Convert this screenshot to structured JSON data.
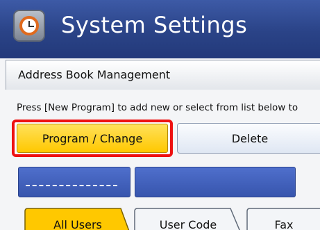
{
  "header": {
    "title": "System Settings",
    "icon": "system-settings-clock-icon"
  },
  "subheader": {
    "title": "Address Book Management"
  },
  "instruction": "Press [New Program] to add new or select from list below to",
  "buttons": {
    "program_change": "Program / Change",
    "delete": "Delete"
  },
  "fields": {
    "first_placeholder": "------"
  },
  "tabs": [
    {
      "label": "All Users",
      "selected": true
    },
    {
      "label": "User Code",
      "selected": false
    },
    {
      "label": "Fax",
      "selected": false
    }
  ],
  "colors": {
    "header_bg": "#2a4387",
    "highlight_frame": "#ee1111",
    "selected_button": "#ffc800",
    "field_bg": "#3755ad"
  }
}
